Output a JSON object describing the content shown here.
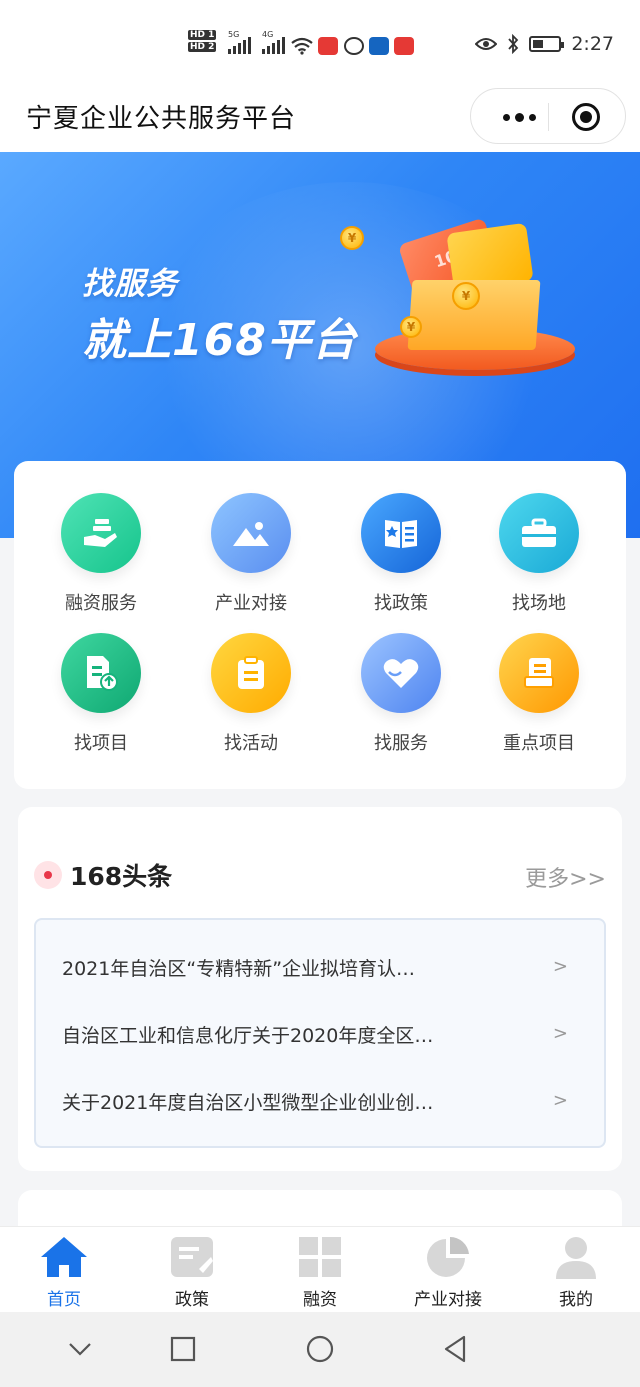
{
  "status_bar": {
    "hd1": "HD 1",
    "hd2": "HD 2",
    "net1": "5G",
    "net2": "4G",
    "time": "2:27"
  },
  "header": {
    "title": "宁夏企业公共服务平台"
  },
  "banner": {
    "line1": "找服务",
    "line2": "就上168平台",
    "card_text": "100",
    "coin_symbol": "¥"
  },
  "services": [
    {
      "label": "融资服务",
      "icon": "finance-hand-icon",
      "color": "#2fd6a0"
    },
    {
      "label": "产业对接",
      "icon": "mountain-image-icon",
      "color": "#5d9df5"
    },
    {
      "label": "找政策",
      "icon": "policy-book-icon",
      "color": "#1e88e5"
    },
    {
      "label": "找场地",
      "icon": "briefcase-icon",
      "color": "#26c6da"
    },
    {
      "label": "找项目",
      "icon": "project-upload-icon",
      "color": "#1bbf84"
    },
    {
      "label": "找活动",
      "icon": "activity-list-icon",
      "color": "#ffb300"
    },
    {
      "label": "找服务",
      "icon": "heart-service-icon",
      "color": "#6a9ef7"
    },
    {
      "label": "重点项目",
      "icon": "key-project-icon",
      "color": "#ffa000"
    }
  ],
  "news": {
    "title": "168头条",
    "more": "更多>>",
    "items": [
      {
        "text": "2021年自治区“专精特新”企业拟培育认…",
        "arrow": ">"
      },
      {
        "text": "自治区工业和信息化厅关于2020年度全区…",
        "arrow": ">"
      },
      {
        "text": "关于2021年度自治区小型微型企业创业创…",
        "arrow": ">"
      }
    ]
  },
  "tabbar": {
    "items": [
      {
        "label": "首页",
        "icon": "home-icon",
        "active": true
      },
      {
        "label": "政策",
        "icon": "policy-icon",
        "active": false
      },
      {
        "label": "融资",
        "icon": "grid-icon",
        "active": false
      },
      {
        "label": "产业对接",
        "icon": "pie-chart-icon",
        "active": false
      },
      {
        "label": "我的",
        "icon": "user-icon",
        "active": false
      }
    ]
  },
  "colors": {
    "accent": "#1a73e8",
    "banner_blue": "#2f86f6",
    "news_dot": "#e8374a"
  }
}
